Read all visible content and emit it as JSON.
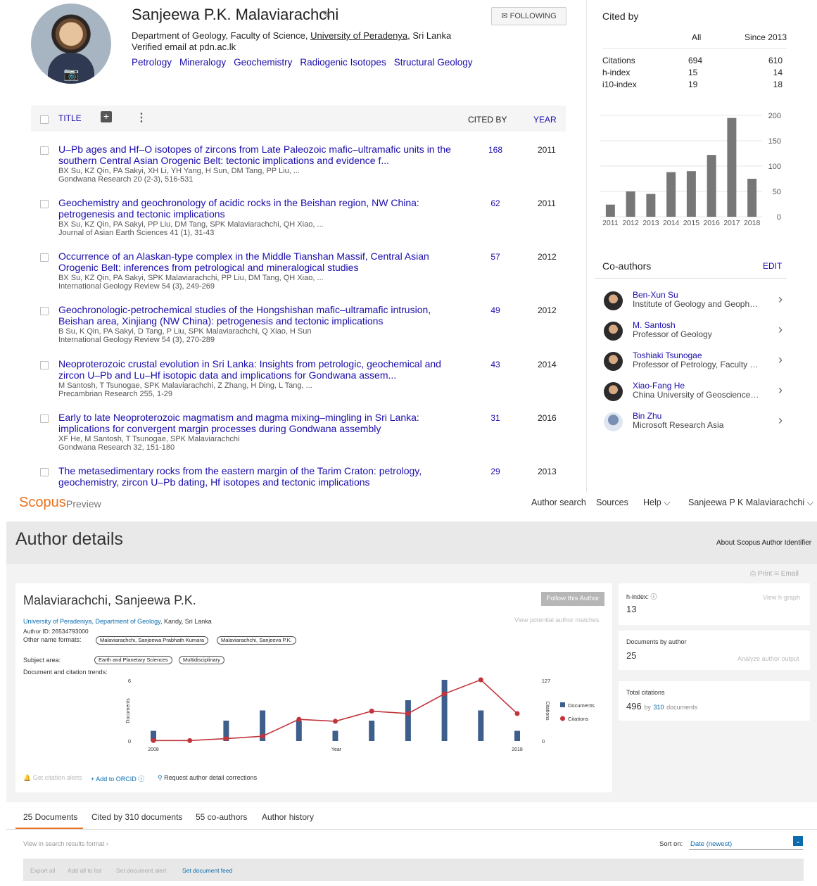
{
  "scholar": {
    "name": "Sanjeewa P.K. Malaviarachchi",
    "follow_label": "FOLLOWING",
    "affiliation_pre": "Department of Geology, Faculty of Science, ",
    "affiliation_link": "University of Peradenya",
    "affiliation_post": ", Sri Lanka",
    "email": "Verified email at pdn.ac.lk",
    "interests": [
      "Petrology",
      "Mineralogy",
      "Geochemistry",
      "Radiogenic Isotopes",
      "Structural Geology"
    ],
    "table_headers": {
      "title": "TITLE",
      "cited_by": "CITED BY",
      "year": "YEAR"
    },
    "articles": [
      {
        "title": "U–Pb ages and Hf–O isotopes of zircons from Late Paleozoic mafic–ultramafic units in the southern Central Asian Orogenic Belt: tectonic implications and evidence f...",
        "authors": "BX Su, KZ Qin, PA Sakyi, XH Li, YH Yang, H Sun, DM Tang, PP Liu, ...",
        "journal": "Gondwana Research 20 (2-3), 516-531",
        "cited": "168",
        "year": "2011"
      },
      {
        "title": "Geochemistry and geochronology of acidic rocks in the Beishan region, NW China: petrogenesis and tectonic implications",
        "authors": "BX Su, KZ Qin, PA Sakyi, PP Liu, DM Tang, SPK Malaviarachchi, QH Xiao, ...",
        "journal": "Journal of Asian Earth Sciences 41 (1), 31-43",
        "cited": "62",
        "year": "2011"
      },
      {
        "title": "Occurrence of an Alaskan-type complex in the Middle Tianshan Massif, Central Asian Orogenic Belt: inferences from petrological and mineralogical studies",
        "authors": "BX Su, KZ Qin, PA Sakyi, SPK Malaviarachchi, PP Liu, DM Tang, QH Xiao, ...",
        "journal": "International Geology Review 54 (3), 249-269",
        "cited": "57",
        "year": "2012"
      },
      {
        "title": "Geochronologic-petrochemical studies of the Hongshishan mafic–ultramafic intrusion, Beishan area, Xinjiang (NW China): petrogenesis and tectonic implications",
        "authors": "B Su, K Qin, PA Sakyi, D Tang, P Liu, SPK Malaviarachchi, Q Xiao, H Sun",
        "journal": "International Geology Review 54 (3), 270-289",
        "cited": "49",
        "year": "2012"
      },
      {
        "title": "Neoproterozoic crustal evolution in Sri Lanka: Insights from petrologic, geochemical and zircon U–Pb and Lu–Hf isotopic data and implications for Gondwana assem...",
        "authors": "M Santosh, T Tsunogae, SPK Malaviarachchi, Z Zhang, H Ding, L Tang, ...",
        "journal": "Precambrian Research 255, 1-29",
        "cited": "43",
        "year": "2014"
      },
      {
        "title": "Early to late Neoproterozoic magmatism and magma mixing–mingling in Sri Lanka: implications for convergent margin processes during Gondwana assembly",
        "authors": "XF He, M Santosh, T Tsunogae, SPK Malaviarachchi",
        "journal": "Gondwana Research 32, 151-180",
        "cited": "31",
        "year": "2016"
      },
      {
        "title": "The metasedimentary rocks from the eastern margin of the Tarim Craton: petrology, geochemistry, zircon U–Pb dating, Hf isotopes and tectonic implications",
        "authors": "",
        "journal": "",
        "cited": "29",
        "year": "2013"
      }
    ],
    "cited_by": {
      "title": "Cited by",
      "col_all": "All",
      "col_since": "Since 2013",
      "rows": [
        {
          "label": "Citations",
          "all": "694",
          "since": "610"
        },
        {
          "label": "h-index",
          "all": "15",
          "since": "14"
        },
        {
          "label": "i10-index",
          "all": "19",
          "since": "18"
        }
      ]
    },
    "coauthors": {
      "title": "Co-authors",
      "edit_label": "EDIT",
      "items": [
        {
          "name": "Ben-Xun Su",
          "affiliation": "Institute of Geology and Geophysics"
        },
        {
          "name": "M. Santosh",
          "affiliation": "Professor of Geology"
        },
        {
          "name": "Toshiaki Tsunogae",
          "affiliation": "Professor of Petrology, Faculty of Life and Environmental Sciences"
        },
        {
          "name": "Xiao-Fang He",
          "affiliation": "China University of Geosciences, Beijing"
        },
        {
          "name": "Bin Zhu",
          "affiliation": "Microsoft Research Asia"
        }
      ]
    }
  },
  "scopus": {
    "logo": "Scopus",
    "preview": "Preview",
    "nav": {
      "author_search": "Author search",
      "sources": "Sources",
      "help": "Help ⌵",
      "user": "Sanjeewa P K Malaviarachchi ⌵"
    },
    "page_title": "Author details",
    "about_link": "About Scopus Author Identifier",
    "print_email": "⎙ Print   ✉ Email",
    "author_name": "Malaviarachchi, Sanjeewa P.K.",
    "follow_label": "Follow this Author",
    "view_matches": "View potential author matches",
    "aff_link": "University of Peradeniya, Department of Geology",
    "aff_rest": ", Kandy, Sri Lanka",
    "author_id": "Author ID: 26534793000",
    "other_names_label": "Other name formats:",
    "other_names": [
      "Malaviarachchi, Sanjeewa Prabhath Kumara",
      "Malaviarachchi, Sanjeeva P.K."
    ],
    "subject_label": "Subject area:",
    "subjects": [
      "Earth and Planetary Sciences",
      "Multidisciplinary"
    ],
    "trend_label": "Document and citation trends:",
    "actions": {
      "alerts": "Get citation alerts",
      "orcid": "+ Add to ORCID ⓘ",
      "corrections": "Request author detail corrections"
    },
    "hindex": {
      "label": "h-index: ⓘ",
      "value": "13",
      "link": "View h-graph"
    },
    "docs": {
      "label": "Documents by author",
      "value": "25",
      "link": "Analyze author output"
    },
    "citations": {
      "label": "Total citations",
      "value": "496",
      "by": "by",
      "count": "310",
      "suffix": "documents"
    },
    "tabs": [
      "25 Documents",
      "Cited by 310 documents",
      "55 co-authors",
      "Author history"
    ],
    "view_format": "View in search results format ›",
    "sort_label": "Sort on:",
    "sort_value": "Date (newest)",
    "toolbar": [
      "Export all",
      "Add all to list",
      "Set document alert",
      "Set document feed"
    ]
  },
  "chart_data": [
    {
      "type": "bar",
      "title": "",
      "categories": [
        "2011",
        "2012",
        "2013",
        "2014",
        "2015",
        "2016",
        "2017",
        "2018"
      ],
      "values": [
        24,
        50,
        45,
        88,
        90,
        122,
        195,
        75
      ],
      "ylim": [
        0,
        200
      ],
      "yticks": [
        0,
        50,
        100,
        150,
        200
      ],
      "bar_color": "#777777"
    },
    {
      "type": "bar+line",
      "xlabel": "Year",
      "ylabel_left": "Documents",
      "ylabel_right": "Citations",
      "x_tick_labels": [
        "2008",
        "2018"
      ],
      "x": [
        2008,
        2009,
        2010,
        2011,
        2012,
        2013,
        2014,
        2015,
        2016,
        2017,
        2018
      ],
      "ylim_left": [
        0,
        6
      ],
      "ylim_right": [
        0,
        127
      ],
      "series": [
        {
          "name": "Documents",
          "kind": "bar",
          "color": "#3e5e8c",
          "values": [
            1,
            0,
            2,
            3,
            2,
            1,
            2,
            4,
            6,
            3,
            1
          ]
        },
        {
          "name": "Citations",
          "kind": "line",
          "color": "#c0343a",
          "values": [
            1,
            1,
            5,
            10,
            45,
            41,
            62,
            57,
            98,
            127,
            57
          ]
        }
      ]
    }
  ]
}
